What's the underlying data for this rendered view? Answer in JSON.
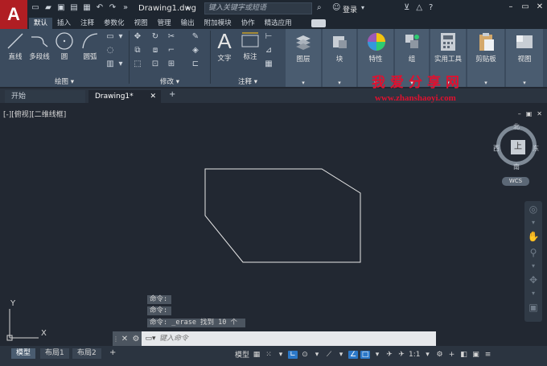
{
  "app": {
    "logo": "A",
    "doc_title": "Drawing1.dwg",
    "search_placeholder": "键入关键字或短语",
    "login": "登录"
  },
  "ribbon_tabs": [
    "默认",
    "插入",
    "注释",
    "参数化",
    "视图",
    "管理",
    "输出",
    "附加模块",
    "协作",
    "精选应用"
  ],
  "ribbon": {
    "draw": {
      "title": "绘图",
      "line": "直线",
      "polyline": "多段线",
      "circle": "圆",
      "arc": "圆弧"
    },
    "modify": {
      "title": "修改"
    },
    "annotation": {
      "title": "注释",
      "text": "文字",
      "dimension": "标注"
    },
    "layers": "图层",
    "block": "块",
    "properties": "特性",
    "groups": "组",
    "utilities": "实用工具",
    "clipboard": "剪贴板",
    "view": "视图"
  },
  "file_tabs": {
    "start": "开始",
    "doc": "Drawing1*"
  },
  "watermark": {
    "title": "我爱分享网",
    "url": "www.zhanshaoyi.com"
  },
  "viewport": {
    "label": "[-][俯视][二维线框]"
  },
  "viewcube": {
    "face": "上",
    "north": "北",
    "south": "南",
    "east": "东",
    "west": "西",
    "wcs": "WCS"
  },
  "ucs": {
    "x": "X",
    "y": "Y"
  },
  "command_history": [
    "命令:",
    "命令:",
    "命令: _erase 找到 10 个"
  ],
  "command_input": {
    "placeholder": "键入命令"
  },
  "layout_tabs": [
    "模型",
    "布局1",
    "布局2"
  ],
  "status": {
    "model": "模型",
    "scale": "1:1"
  },
  "colors": {
    "accent_red": "#b01e23",
    "ribbon_bg": "#3b4b5e",
    "canvas_bg": "#222832",
    "status_on": "#2b78c8"
  }
}
